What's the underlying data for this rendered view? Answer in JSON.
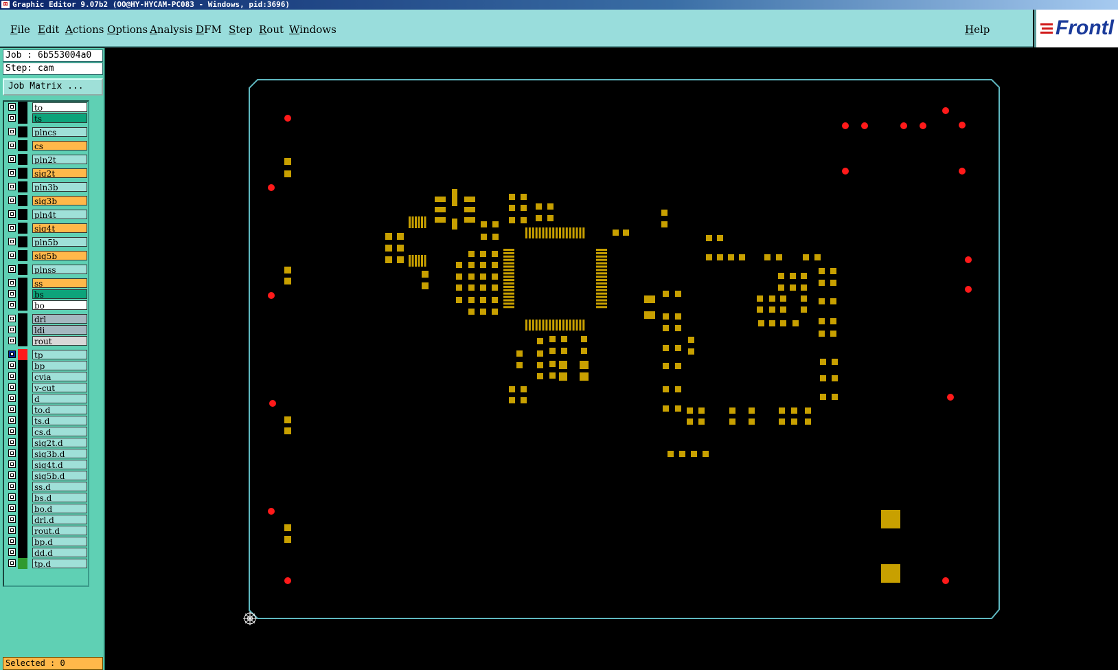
{
  "window": {
    "title": "Graphic Editor 9.07b2 (OO@HY-HYCAM-PC083 - Windows, pid:3696)"
  },
  "menu": {
    "items": [
      "File",
      "Edit",
      "Actions",
      "Options",
      "Analysis",
      "DFM",
      "Step",
      "Rout",
      "Windows"
    ],
    "help": "Help"
  },
  "logo": {
    "text": "Frontl"
  },
  "job": {
    "label": "Job : 6b553004a0",
    "step": "Step: cam"
  },
  "job_matrix_button": "Job Matrix ...",
  "layers": [
    {
      "name": "to",
      "color": "#ffffff"
    },
    {
      "name": "ts",
      "color": "#0da37a"
    },
    {
      "name": "plncs",
      "color": "#9fe0d8"
    },
    {
      "name": "cs",
      "color": "#ffb84a"
    },
    {
      "name": "pln2t",
      "color": "#9fe0d8"
    },
    {
      "name": "sig2t",
      "color": "#ffb84a"
    },
    {
      "name": "pln3b",
      "color": "#9fe0d8"
    },
    {
      "name": "sig3b",
      "color": "#ffb84a"
    },
    {
      "name": "pln4t",
      "color": "#9fe0d8"
    },
    {
      "name": "sig4t",
      "color": "#ffb84a"
    },
    {
      "name": "pln5b",
      "color": "#9fe0d8"
    },
    {
      "name": "sig5b",
      "color": "#ffb84a"
    },
    {
      "name": "plnss",
      "color": "#9fe0d8"
    },
    {
      "name": "ss",
      "color": "#ffb84a"
    },
    {
      "name": "bs",
      "color": "#0da37a"
    },
    {
      "name": "bo",
      "color": "#ffffff"
    },
    {
      "name": "drl",
      "color": "#a5b8c0"
    },
    {
      "name": "ldi",
      "color": "#a5b8c0"
    },
    {
      "name": "rout",
      "color": "#d8d8d8"
    },
    {
      "name": "tp",
      "color": "#9fe0d8",
      "active": true,
      "swatch": "#ff1a1a"
    },
    {
      "name": "bp",
      "color": "#9fe0d8"
    },
    {
      "name": "cvia",
      "color": "#9fe0d8"
    },
    {
      "name": "v-cut",
      "color": "#9fe0d8"
    },
    {
      "name": "d",
      "color": "#9fe0d8"
    },
    {
      "name": "to.d",
      "color": "#9fe0d8"
    },
    {
      "name": "ts.d",
      "color": "#9fe0d8"
    },
    {
      "name": "cs.d",
      "color": "#9fe0d8"
    },
    {
      "name": "sig2t.d",
      "color": "#9fe0d8"
    },
    {
      "name": "sig3b.d",
      "color": "#9fe0d8"
    },
    {
      "name": "sig4t.d",
      "color": "#9fe0d8"
    },
    {
      "name": "sig5b.d",
      "color": "#9fe0d8"
    },
    {
      "name": "ss.d",
      "color": "#9fe0d8"
    },
    {
      "name": "bs.d",
      "color": "#9fe0d8"
    },
    {
      "name": "bo.d",
      "color": "#9fe0d8"
    },
    {
      "name": "drl.d",
      "color": "#9fe0d8"
    },
    {
      "name": "rout.d",
      "color": "#9fe0d8"
    },
    {
      "name": "bp.d",
      "color": "#9fe0d8"
    },
    {
      "name": "dd.d",
      "color": "#9fe0d8"
    },
    {
      "name": "tp.d",
      "color": "#9fe0d8",
      "swatch": "#2f9a2f"
    }
  ],
  "status": {
    "selected": "Selected : 0"
  },
  "colors": {
    "menubar": "#99dddc",
    "panel": "#5fd0b4",
    "board_outline": "#5fb8c0",
    "pad": "#c8a000",
    "testpoint": "#ff1a1a"
  },
  "icons": {
    "origin": "origin-crosshair-icon",
    "app": "app-icon",
    "checkbox": "layer-checkbox-icon"
  }
}
